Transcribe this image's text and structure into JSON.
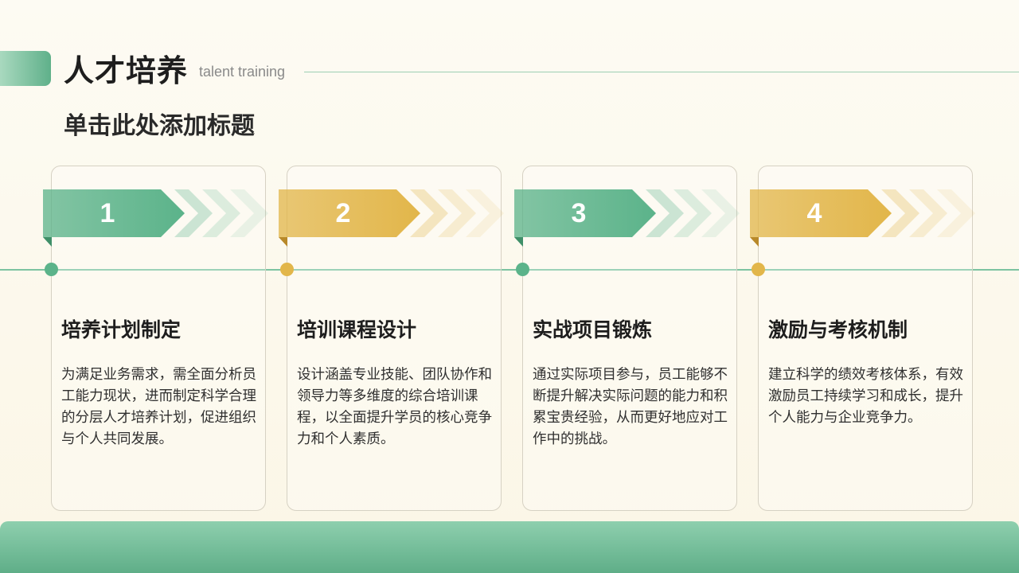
{
  "header": {
    "title": "人才培养",
    "subtitle_en": "talent training",
    "section_heading": "单击此处添加标题"
  },
  "colors": {
    "green": "#5bb38a",
    "green_dark": "#3f8f68",
    "gold": "#e2b64a",
    "gold_dark": "#b8892a"
  },
  "cards": [
    {
      "number": "1",
      "color": "green",
      "title": "培养计划制定",
      "body": "为满足业务需求，需全面分析员工能力现状，进而制定科学合理的分层人才培养计划，促进组织与个人共同发展。"
    },
    {
      "number": "2",
      "color": "gold",
      "title": "培训课程设计",
      "body": "设计涵盖专业技能、团队协作和领导力等多维度的综合培训课程，以全面提升学员的核心竞争力和个人素质。"
    },
    {
      "number": "3",
      "color": "green",
      "title": "实战项目锻炼",
      "body": "通过实际项目参与，员工能够不断提升解决实际问题的能力和积累宝贵经验，从而更好地应对工作中的挑战。"
    },
    {
      "number": "4",
      "color": "gold",
      "title": "激励与考核机制",
      "body": "建立科学的绩效考核体系，有效激励员工持续学习和成长，提升个人能力与企业竞争力。"
    }
  ]
}
